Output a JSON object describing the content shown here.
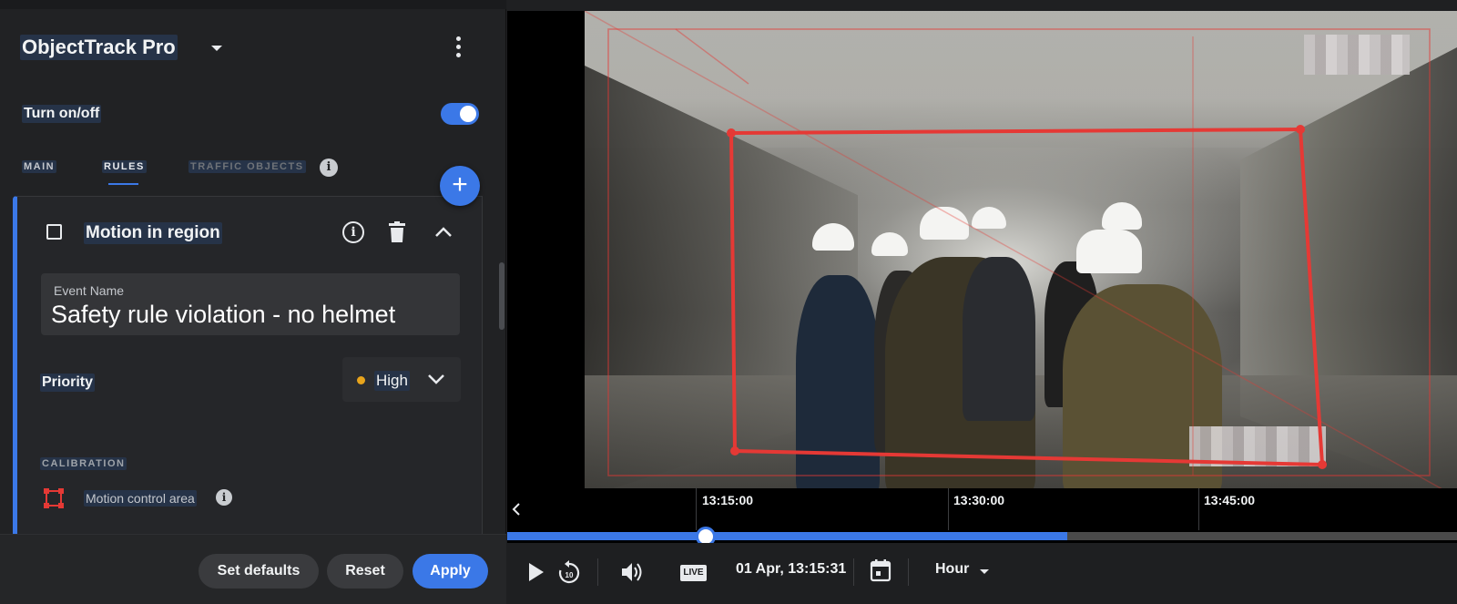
{
  "app": {
    "title": "ObjectTrack Pro",
    "menu_icon": "more-vertical-icon",
    "dropdown_icon": "caret-down-icon"
  },
  "power": {
    "label": "Turn on/off",
    "enabled": true
  },
  "tabs": [
    {
      "label": "MAIN",
      "active": false
    },
    {
      "label": "RULES",
      "active": true
    },
    {
      "label": "TRAFFIC OBJECTS",
      "active": false
    }
  ],
  "rule": {
    "title": "Motion in region",
    "checked": false,
    "event_name_label": "Event Name",
    "event_name_value": "Safety rule violation - no helmet",
    "priority_label": "Priority",
    "priority_value": "High",
    "priority_color": "#e8a41c",
    "calibration_label": "CALIBRATION",
    "area_label": "Motion control area",
    "area_color": "#e53935"
  },
  "footer": {
    "set_defaults": "Set defaults",
    "reset": "Reset",
    "apply": "Apply"
  },
  "timeline": {
    "ticks": [
      "13:15:00",
      "13:30:00",
      "13:45:00"
    ],
    "progress_fraction": 0.59,
    "playhead_fraction": 0.209
  },
  "player": {
    "live_label": "LIVE",
    "timestamp": "01 Apr, 13:15:31",
    "scale": "Hour",
    "rewind_seconds": "10"
  },
  "colors": {
    "accent": "#3b78e7",
    "region": "#e53935"
  }
}
